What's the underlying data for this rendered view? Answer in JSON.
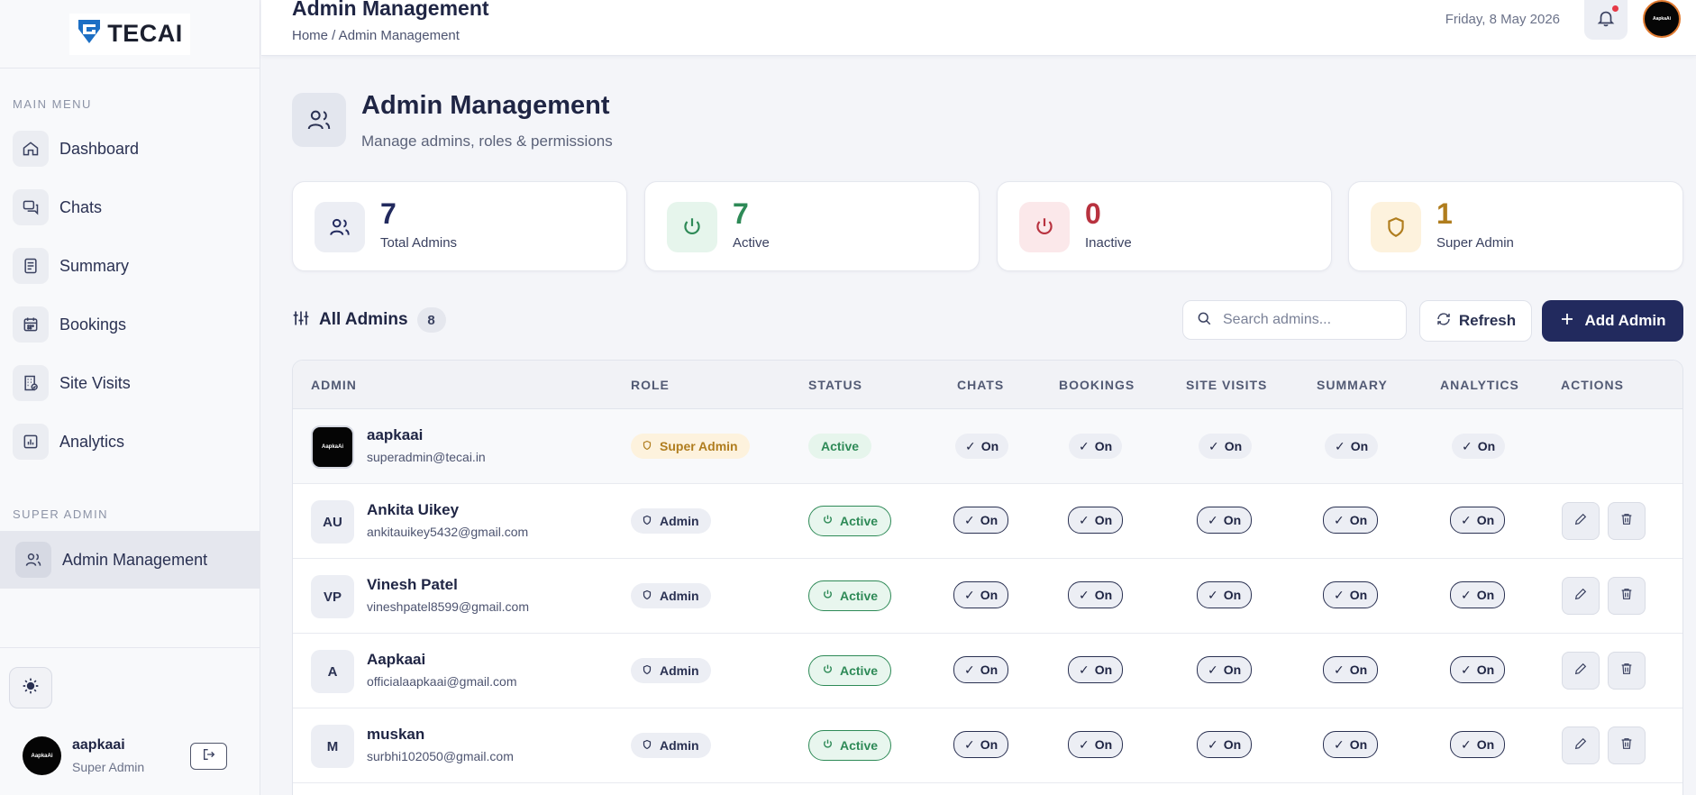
{
  "brand": {
    "logo_text": "TECAI",
    "accent": "#222a5e"
  },
  "sidebar": {
    "main_menu_label": "MAIN MENU",
    "items": [
      {
        "label": "Dashboard",
        "icon": "home-icon"
      },
      {
        "label": "Chats",
        "icon": "chat-icon"
      },
      {
        "label": "Summary",
        "icon": "document-icon"
      },
      {
        "label": "Bookings",
        "icon": "calendar-icon"
      },
      {
        "label": "Site Visits",
        "icon": "building-icon"
      },
      {
        "label": "Analytics",
        "icon": "chart-icon"
      }
    ],
    "super_admin_label": "SUPER ADMIN",
    "active_item": {
      "label": "Admin Management",
      "icon": "users-icon"
    },
    "user": {
      "avatar_text": "AapkaAi",
      "name": "aapkaai",
      "role": "Super Admin"
    }
  },
  "topbar": {
    "title": "Admin Management",
    "breadcrumb": "Home / Admin Management",
    "date": "Friday, 8 May 2026",
    "avatar_text": "AapkaAi"
  },
  "page": {
    "title": "Admin Management",
    "subtitle": "Manage admins, roles & permissions"
  },
  "stats": [
    {
      "value": "7",
      "label": "Total Admins",
      "color": "#222a5e",
      "icon_bg": "#eceef4",
      "icon": "users-icon"
    },
    {
      "value": "7",
      "label": "Active",
      "color": "#2e8a57",
      "icon_bg": "#e6f5ec",
      "icon": "power-icon"
    },
    {
      "value": "0",
      "label": "Inactive",
      "color": "#b8323f",
      "icon_bg": "#fbe8ea",
      "icon": "power-icon"
    },
    {
      "value": "1",
      "label": "Super Admin",
      "color": "#b07d1e",
      "icon_bg": "#fdf2dd",
      "icon": "shield-icon"
    }
  ],
  "toolbar": {
    "all_admins_label": "All Admins",
    "count": "8",
    "search_placeholder": "Search admins...",
    "refresh_label": "Refresh",
    "add_label": "Add Admin"
  },
  "table": {
    "headers": [
      "ADMIN",
      "ROLE",
      "STATUS",
      "CHATS",
      "BOOKINGS",
      "SITE VISITS",
      "SUMMARY",
      "ANALYTICS",
      "ACTIONS"
    ],
    "rows": [
      {
        "initials": "AapkaAi",
        "name": "aapkaai",
        "email": "superadmin@tecai.in",
        "role": "Super Admin",
        "status": "Active",
        "chats": "On",
        "bookings": "On",
        "site_visits": "On",
        "summary": "On",
        "analytics": "On"
      },
      {
        "initials": "AU",
        "name": "Ankita Uikey",
        "email": "ankitauikey5432@gmail.com",
        "role": "Admin",
        "status": "Active",
        "chats": "On",
        "bookings": "On",
        "site_visits": "On",
        "summary": "On",
        "analytics": "On"
      },
      {
        "initials": "VP",
        "name": "Vinesh Patel",
        "email": "vineshpatel8599@gmail.com",
        "role": "Admin",
        "status": "Active",
        "chats": "On",
        "bookings": "On",
        "site_visits": "On",
        "summary": "On",
        "analytics": "On"
      },
      {
        "initials": "A",
        "name": "Aapkaai",
        "email": "officialaapkaai@gmail.com",
        "role": "Admin",
        "status": "Active",
        "chats": "On",
        "bookings": "On",
        "site_visits": "On",
        "summary": "On",
        "analytics": "On"
      },
      {
        "initials": "M",
        "name": "muskan",
        "email": "surbhi102050@gmail.com",
        "role": "Admin",
        "status": "Active",
        "chats": "On",
        "bookings": "On",
        "site_visits": "On",
        "summary": "On",
        "analytics": "On"
      }
    ]
  }
}
